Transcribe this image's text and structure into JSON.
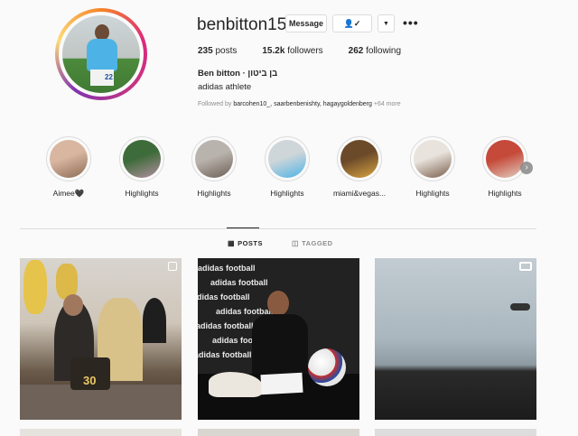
{
  "profile": {
    "username": "benbitton15",
    "message_label": "Message",
    "following_icon": "person-check-icon",
    "dropdown_icon": "caret-down-icon",
    "more_icon": "more-dots-icon",
    "posts_count": "235",
    "posts_label": "posts",
    "followers_count": "15.2k",
    "followers_label": "followers",
    "following_count": "262",
    "following_label": "following",
    "full_name": "Ben bitton · בן ביטון",
    "bio": "adidas athlete",
    "followed_by_prefix": "Followed by",
    "followed_by_users": "barcohen10_, saarbenbenishty, hagaygoldenberg",
    "followed_by_more": "+64 more"
  },
  "highlights": [
    {
      "label": "Aimee🖤",
      "colors": [
        "#d9b6a0",
        "#8c6a55"
      ]
    },
    {
      "label": "Highlights",
      "colors": [
        "#3e6b3a",
        "#b38fa0"
      ]
    },
    {
      "label": "Highlights",
      "colors": [
        "#b9b3ad",
        "#6d5e55"
      ]
    },
    {
      "label": "Highlights",
      "colors": [
        "#cfd6d9",
        "#4db3e6"
      ]
    },
    {
      "label": "miami&vegas...",
      "colors": [
        "#6b4a2a",
        "#d9a440"
      ]
    },
    {
      "label": "Highlights",
      "colors": [
        "#e8e3dc",
        "#7a5c4a"
      ]
    },
    {
      "label": "Highlights",
      "colors": [
        "#c54a3a",
        "#e2cfc2"
      ]
    }
  ],
  "tabs": {
    "posts_label": "POSTS",
    "tagged_label": "TAGGED"
  },
  "posts": {
    "cake_text": "30",
    "adidas_text": "adidas football"
  },
  "colors": {
    "border": "#dbdbdb",
    "text": "#262626",
    "muted": "#8e8e8e",
    "background": "#fafafa"
  }
}
